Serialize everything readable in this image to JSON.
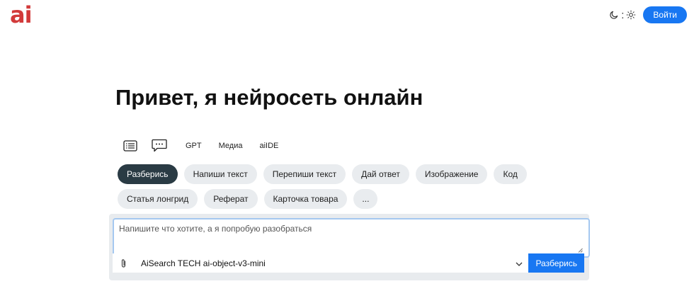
{
  "header": {
    "logo_text": "ai",
    "login_label": "Войти",
    "theme_separator": ":"
  },
  "title": "Привет, я нейросеть онлайн",
  "modes": {
    "icons": [
      "list-icon",
      "chat-bubble-icon"
    ],
    "tabs": [
      "GPT",
      "Медиа",
      "aiIDE"
    ]
  },
  "chips": [
    {
      "label": "Разберись",
      "active": true
    },
    {
      "label": "Напиши текст",
      "active": false
    },
    {
      "label": "Перепиши текст",
      "active": false
    },
    {
      "label": "Дай ответ",
      "active": false
    },
    {
      "label": "Изображение",
      "active": false
    },
    {
      "label": "Код",
      "active": false
    },
    {
      "label": "Статья лонгрид",
      "active": false
    },
    {
      "label": "Реферат",
      "active": false
    },
    {
      "label": "Карточка товара",
      "active": false
    },
    {
      "label": "...",
      "active": false
    }
  ],
  "composer": {
    "placeholder": "Напишите что хотите, а я попробую разобраться",
    "value": "",
    "model": "AiSearch TECH ai-object-v3-mini",
    "submit_label": "Разберись"
  },
  "colors": {
    "accent": "#1877f2",
    "logo": "#d23a3a",
    "active_chip": "#2a3b44"
  }
}
